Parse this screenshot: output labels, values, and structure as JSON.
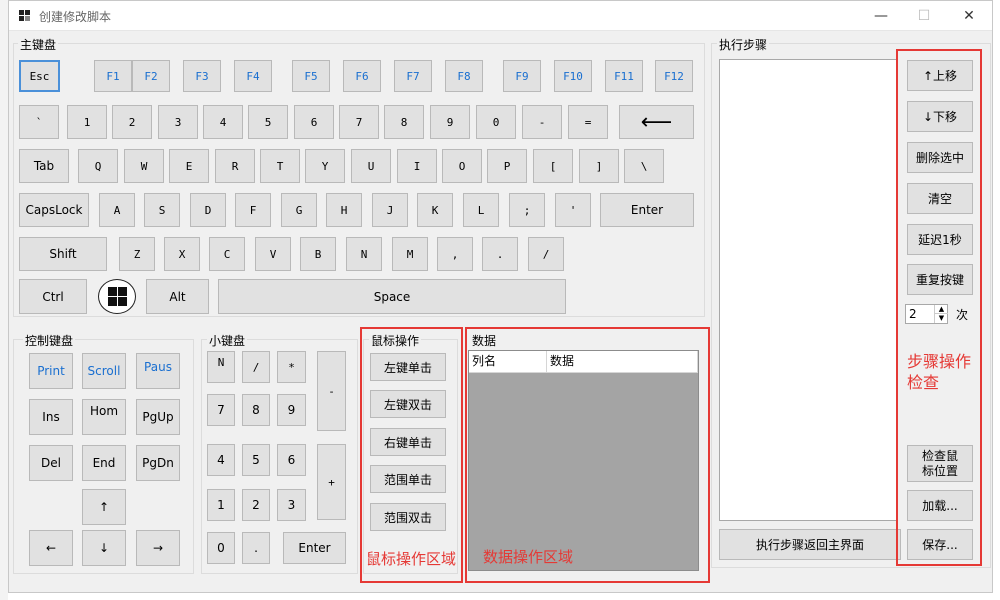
{
  "window": {
    "title": "创建修改脚本",
    "minimize": "—",
    "maximize": "☐",
    "close": "✕"
  },
  "groups": {
    "main_keyboard": "主键盘",
    "control_keyboard": "控制键盘",
    "numpad": "小键盘",
    "mouse": "鼠标操作",
    "data": "数据",
    "steps": "执行步骤"
  },
  "keys": {
    "row0": [
      "Esc",
      "F1",
      "F2",
      "F3",
      "F4",
      "F5",
      "F6",
      "F7",
      "F8",
      "F9",
      "F10",
      "F11",
      "F12"
    ],
    "row1": [
      "`",
      "1",
      "2",
      "3",
      "4",
      "5",
      "6",
      "7",
      "8",
      "9",
      "0",
      "-",
      "=",
      "⟵"
    ],
    "row2": [
      "Tab",
      "Q",
      "W",
      "E",
      "R",
      "T",
      "Y",
      "U",
      "I",
      "O",
      "P",
      "[",
      "]",
      "\\"
    ],
    "row3": [
      "CapsLock",
      "A",
      "S",
      "D",
      "F",
      "G",
      "H",
      "J",
      "K",
      "L",
      ";",
      "'",
      "Enter"
    ],
    "row4": [
      "Shift",
      "Z",
      "X",
      "C",
      "V",
      "B",
      "N",
      "M",
      ",",
      ".",
      "/"
    ],
    "row5": [
      "Ctrl",
      "",
      "Alt",
      "Space"
    ]
  },
  "control_keys": [
    "Print",
    "Scroll",
    "Paus",
    "Ins",
    "Hom",
    "PgUp",
    "Del",
    "End",
    "PgDn",
    "↑",
    "←",
    "↓",
    "→"
  ],
  "numpad_keys": [
    "N",
    "/",
    "*",
    "-",
    "7",
    "8",
    "9",
    "+",
    "4",
    "5",
    "6",
    "1",
    "2",
    "3",
    "0",
    ".",
    "Enter"
  ],
  "mouse_buttons": [
    "左键单击",
    "左键双击",
    "右键单击",
    "范围单击",
    "范围双击"
  ],
  "data_columns": [
    "列名",
    "数据"
  ],
  "step_buttons": {
    "up": "↑上移",
    "down": "↓下移",
    "delete": "删除选中",
    "clear": "清空",
    "delay": "延迟1秒",
    "repeat": "重复按键",
    "repeat_count": "2",
    "times_label": "次",
    "check_mouse": "检查鼠\n标位置",
    "load": "加载...",
    "save": "保存...",
    "return": "执行步骤返回主界面"
  },
  "annotations": {
    "mouse_area": "鼠标操作区域",
    "data_area": "数据操作区域",
    "step_area": "步骤操作\n检查"
  },
  "colors": {
    "annotation_red": "#e53935",
    "fkey_blue": "#1a6fd0",
    "grid_gray": "#a4a4a4"
  }
}
